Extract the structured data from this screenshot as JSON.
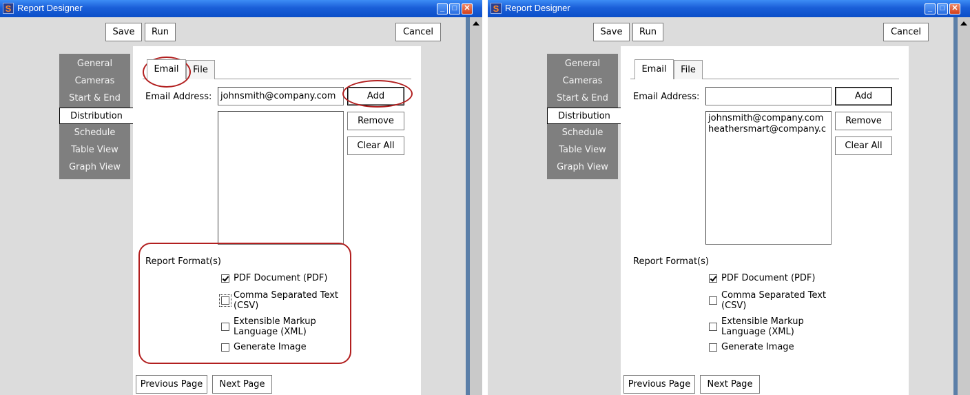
{
  "windows": [
    {
      "title": "Report Designer",
      "toolbar": {
        "save_label": "Save",
        "run_label": "Run",
        "cancel_label": "Cancel"
      },
      "nav": [
        "General",
        "Cameras",
        "Start & End",
        "Distribution",
        "Schedule",
        "Table View",
        "Graph View"
      ],
      "active_nav": "Distribution",
      "tabs": [
        "Email",
        "File"
      ],
      "active_tab": "Email",
      "email_label": "Email Address:",
      "email_value": "johnsmith@company.com",
      "add_label": "Add",
      "remove_label": "Remove",
      "clear_label": "Clear All",
      "recipients": [],
      "format_title": "Report Format(s)",
      "formats": [
        {
          "line1": "PDF Document (PDF)",
          "line2": "",
          "checked": true
        },
        {
          "line1": "Comma Separated Text",
          "line2": "(CSV)",
          "checked": false
        },
        {
          "line1": "Extensible Markup",
          "line2": "Language (XML)",
          "checked": false
        },
        {
          "line1": "Generate Image",
          "line2": "",
          "checked": false
        }
      ],
      "prev_label": "Previous Page",
      "next_label": "Next Page"
    },
    {
      "title": "Report Designer",
      "toolbar": {
        "save_label": "Save",
        "run_label": "Run",
        "cancel_label": "Cancel"
      },
      "nav": [
        "General",
        "Cameras",
        "Start & End",
        "Distribution",
        "Schedule",
        "Table View",
        "Graph View"
      ],
      "active_nav": "Distribution",
      "tabs": [
        "Email",
        "File"
      ],
      "active_tab": "Email",
      "email_label": "Email Address:",
      "email_value": "",
      "add_label": "Add",
      "remove_label": "Remove",
      "clear_label": "Clear All",
      "recipients": [
        "johnsmith@company.com",
        "heathersmart@company.c"
      ],
      "format_title": "Report Format(s)",
      "formats": [
        {
          "line1": "PDF Document (PDF)",
          "line2": "",
          "checked": true
        },
        {
          "line1": "Comma Separated Text",
          "line2": "(CSV)",
          "checked": false
        },
        {
          "line1": "Extensible Markup",
          "line2": "Language (XML)",
          "checked": false
        },
        {
          "line1": "Generate Image",
          "line2": "",
          "checked": false
        }
      ],
      "prev_label": "Previous Page",
      "next_label": "Next Page"
    }
  ],
  "colors": {
    "annotation": "#b21f1f",
    "titlebar": "#1a5fd8",
    "nav_bg": "#7f7f7f"
  }
}
